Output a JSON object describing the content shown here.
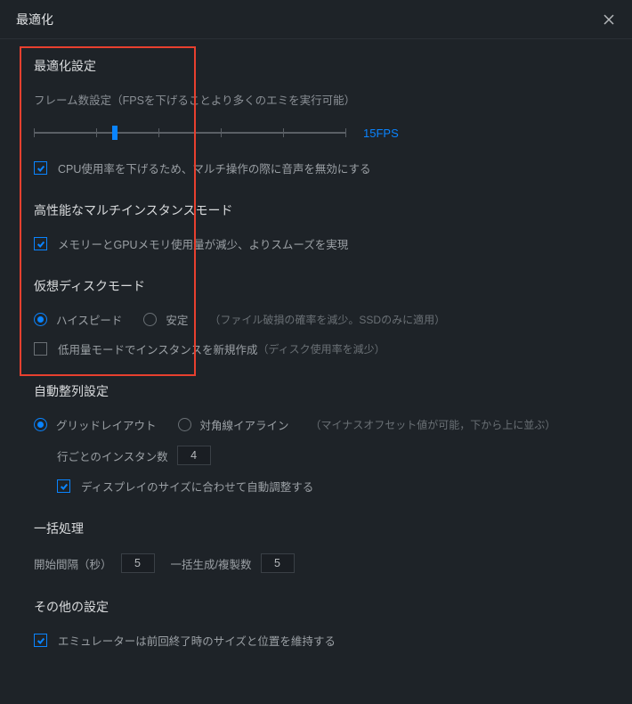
{
  "header": {
    "title": "最適化"
  },
  "optimization": {
    "title": "最適化設定",
    "fps_label": "フレーム数設定（FPSを下げることより多くのエミを実行可能）",
    "fps_value": "15FPS",
    "cpu_audio_label": "CPU使用率を下げるため、マルチ操作の際に音声を無効にする"
  },
  "multi_instance": {
    "title": "高性能なマルチインスタンスモード",
    "memory_label": "メモリーとGPUメモリ使用量が減少、よりスムーズを実現"
  },
  "virtual_disk": {
    "title": "仮想ディスクモード",
    "high_speed": "ハイスピード",
    "stable": "安定",
    "stable_hint": "（ファイル破損の確率を減少。SSDのみに適用）",
    "low_usage": "低用量モードでインスタンスを新規作成",
    "low_usage_hint": "（ディスク使用率を減少）"
  },
  "auto_arrange": {
    "title": "自動整列設定",
    "grid": "グリッドレイアウト",
    "diagonal": "対角線イアライン",
    "diagonal_hint": "（マイナスオフセット値が可能，下から上に並ぶ）",
    "per_row_label": "行ごとのインスタン数",
    "per_row_value": "4",
    "auto_adjust": "ディスプレイのサイズに合わせて自動調整する"
  },
  "batch": {
    "title": "一括処理",
    "start_interval_label": "開始間隔（秒）",
    "start_interval_value": "5",
    "batch_count_label": "一括生成/複製数",
    "batch_count_value": "5"
  },
  "other": {
    "title": "その他の設定",
    "remember_size": "エミュレーターは前回終了時のサイズと位置を維持する"
  }
}
